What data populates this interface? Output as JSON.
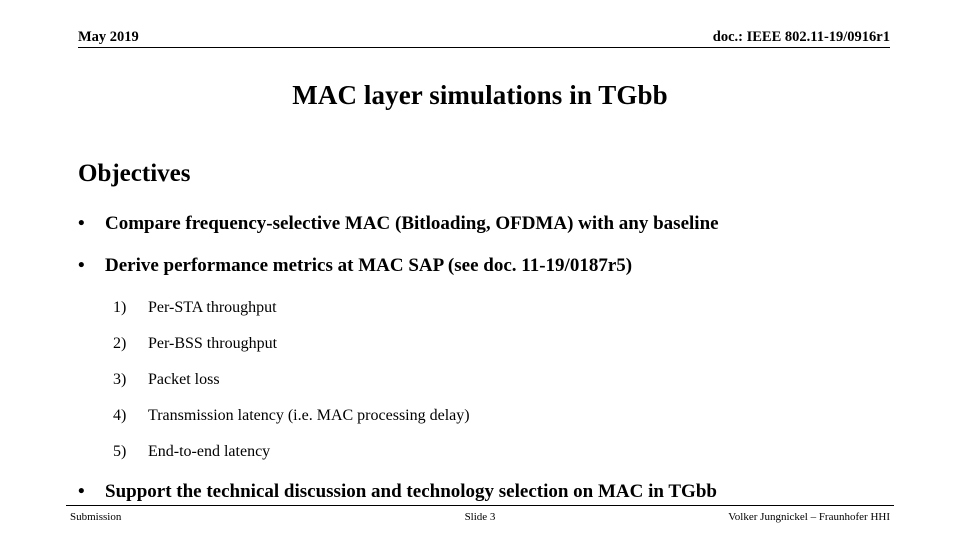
{
  "header": {
    "date": "May 2019",
    "doc_ref": "doc.: IEEE 802.11-19/0916r1"
  },
  "title": "MAC layer simulations in TGbb",
  "body": {
    "section_heading": "Objectives",
    "bullets": [
      {
        "marker": "•",
        "text": "Compare frequency-selective MAC (Bitloading, OFDMA) with any baseline"
      },
      {
        "marker": "•",
        "text": "Derive performance metrics at MAC SAP (see doc. 11-19/0187r5)"
      },
      {
        "marker": "•",
        "text": "Support the technical discussion and technology selection on MAC in TGbb"
      }
    ],
    "metrics": [
      {
        "num": "1)",
        "text": "Per-STA throughput"
      },
      {
        "num": "2)",
        "text": "Per-BSS throughput"
      },
      {
        "num": "3)",
        "text": "Packet loss"
      },
      {
        "num": "4)",
        "text": "Transmission latency (i.e. MAC processing delay)"
      },
      {
        "num": "5)",
        "text": "End-to-end latency"
      }
    ]
  },
  "footer": {
    "left": "Submission",
    "center": "Slide 3",
    "right": "Volker Jungnickel – Fraunhofer HHI"
  },
  "colors": {
    "background": "#ffffff",
    "text": "#000000",
    "rule": "#000000"
  }
}
